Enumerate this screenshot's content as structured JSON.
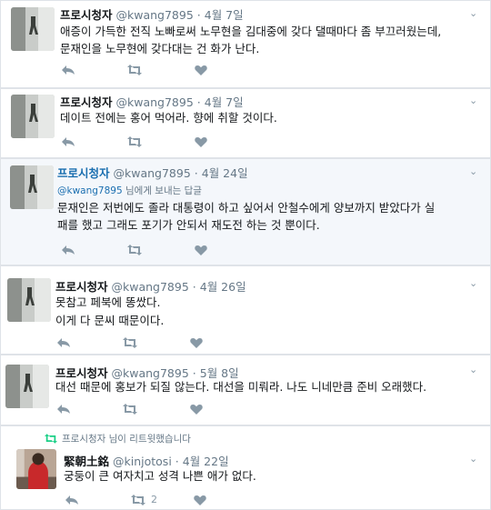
{
  "tweets": [
    {
      "name": "프로시청자",
      "handle": "@kwang7895",
      "time": "4월 7일",
      "sep": "·",
      "lines": [
        "애증이 가득한 전직 노빠로써 노무현을 김대중에 갖다 댈때마다 좀 부끄러웠는데,",
        "문재인을 노무현에 갖다대는 건 화가 난다."
      ]
    },
    {
      "name": "프로시청자",
      "handle": "@kwang7895",
      "time": "4월 7일",
      "sep": "·",
      "lines": [
        "데이트 전에는 홍어 먹어라. 향에 취할 것이다."
      ]
    },
    {
      "name": "프로시청자",
      "handle": "@kwang7895",
      "time": "4월 24일",
      "sep": "·",
      "reply_handle": "@kwang7895",
      "reply_text": " 님에게 보내는 답글",
      "lines": [
        "문재인은 저번에도 졸라 대통령이 하고 싶어서 안철수에게 양보까지 받았다가 실",
        "패를 했고 그래도 포기가 안되서 재도전 하는 것 뿐이다."
      ]
    },
    {
      "name": "프로시청자",
      "handle": "@kwang7895",
      "time": "4월 26일",
      "sep": "·",
      "lines": [
        "못참고 페북에 똥쌌다.",
        "이게 다 문씨 때문이다."
      ]
    },
    {
      "name": "프로시청자",
      "handle": "@kwang7895",
      "time": "5월 8일",
      "sep": "·",
      "lines": [
        "대선 때문에 홍보가 되질 않는다. 대선을 미뤄라. 나도 니네만큼 준비 오래했다."
      ]
    },
    {
      "retweet_note": "프로시청자 님이 리트윗했습니다",
      "name": "緊朝土銘",
      "handle": "@kinjotosi",
      "time": "4월 22일",
      "sep": "·",
      "lines": [
        "궁둥이 큰 여자치고 성격 나쁜 애가 없다."
      ],
      "retweet_count": "2"
    }
  ],
  "icons": {
    "reply": "reply-icon",
    "retweet": "retweet-icon",
    "like": "heart-icon",
    "more": "chevron-down-icon"
  },
  "colors": {
    "action_gray": "#8899a6",
    "link_blue": "#1b6fb0",
    "muted": "#657786",
    "retweet_green": "#19cf86"
  }
}
